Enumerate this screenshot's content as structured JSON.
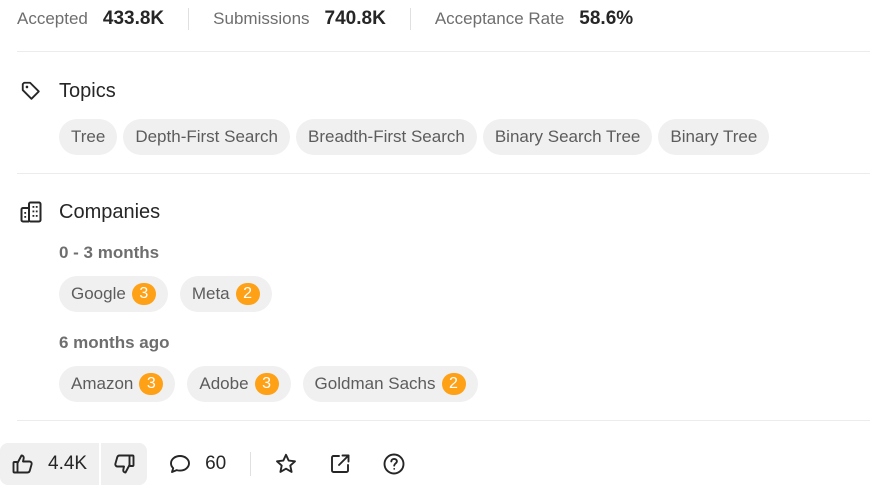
{
  "stats": {
    "accepted_label": "Accepted",
    "accepted_value": "433.8K",
    "submissions_label": "Submissions",
    "submissions_value": "740.8K",
    "acceptance_label": "Acceptance Rate",
    "acceptance_value": "58.6%"
  },
  "topics": {
    "title": "Topics",
    "icon": "tag-icon",
    "tags": [
      "Tree",
      "Depth-First Search",
      "Breadth-First Search",
      "Binary Search Tree",
      "Binary Tree"
    ]
  },
  "companies": {
    "title": "Companies",
    "icon": "building-icon",
    "badge_color": "#ffa116",
    "groups": [
      {
        "label": "0 - 3 months",
        "items": [
          {
            "name": "Google",
            "count": "3"
          },
          {
            "name": "Meta",
            "count": "2"
          }
        ]
      },
      {
        "label": "6 months ago",
        "items": [
          {
            "name": "Amazon",
            "count": "3"
          },
          {
            "name": "Adobe",
            "count": "3"
          },
          {
            "name": "Goldman Sachs",
            "count": "2"
          }
        ]
      }
    ]
  },
  "toolbar": {
    "likes": "4.4K",
    "comments": "60",
    "icons": [
      "thumbs-up-icon",
      "thumbs-down-icon",
      "comment-icon",
      "star-icon",
      "share-icon",
      "help-icon"
    ]
  }
}
